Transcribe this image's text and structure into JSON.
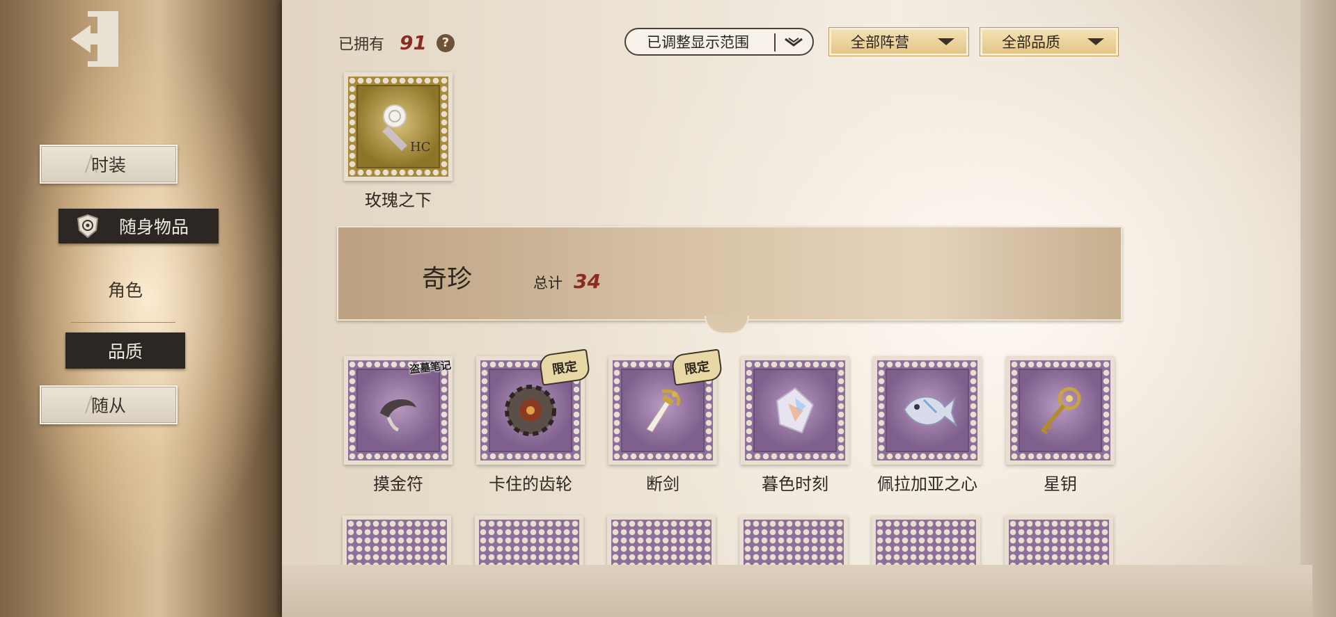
{
  "sidebar": {
    "items": [
      {
        "label": "时装",
        "style": "light"
      },
      {
        "label": "随身物品",
        "style": "dark-selected",
        "icon": "shield-emblem-icon"
      },
      {
        "label": "角色",
        "style": "text"
      },
      {
        "label": "品质",
        "style": "dark"
      },
      {
        "label": "随从",
        "style": "light"
      }
    ]
  },
  "header": {
    "owned_label": "已拥有",
    "owned_count": "91",
    "help": "?",
    "filters": [
      {
        "label": "已调整显示范围"
      },
      {
        "label": "全部阵营"
      },
      {
        "label": "全部品质"
      }
    ]
  },
  "top_item": {
    "name": "玫瑰之下",
    "stamp": "gold",
    "icon": "rose-stamp-icon"
  },
  "section": {
    "title": "奇珍",
    "total_label": "总计",
    "total_value": "34"
  },
  "items": [
    {
      "name": "摸金符",
      "icon": "amulet-icon",
      "tag": "盗墓笔记"
    },
    {
      "name": "卡住的齿轮",
      "icon": "gear-icon",
      "tag": "限定"
    },
    {
      "name": "断剑",
      "icon": "broken-sword-icon",
      "tag": "限定"
    },
    {
      "name": "暮色时刻",
      "icon": "crystal-icon",
      "tag": ""
    },
    {
      "name": "佩拉加亚之心",
      "icon": "fish-icon",
      "tag": ""
    },
    {
      "name": "星钥",
      "icon": "star-key-icon",
      "tag": ""
    }
  ],
  "colors": {
    "accent_red": "#8a2b24",
    "stamp_purple": "#8e6f99",
    "stamp_gold": "#a68a3a"
  }
}
